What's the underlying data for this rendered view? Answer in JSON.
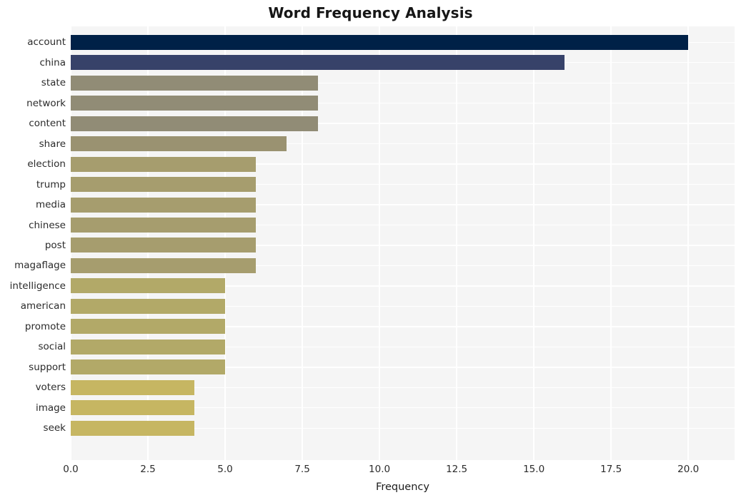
{
  "chart_data": {
    "type": "bar",
    "orientation": "horizontal",
    "title": "Word Frequency Analysis",
    "xlabel": "Frequency",
    "ylabel": "",
    "categories": [
      "account",
      "china",
      "state",
      "network",
      "content",
      "share",
      "election",
      "trump",
      "media",
      "chinese",
      "post",
      "magaflage",
      "intelligence",
      "american",
      "promote",
      "social",
      "support",
      "voters",
      "image",
      "seek"
    ],
    "values": [
      20,
      16,
      8,
      8,
      8,
      7,
      6,
      6,
      6,
      6,
      6,
      6,
      5,
      5,
      5,
      5,
      5,
      4,
      4,
      4
    ],
    "bar_colors": [
      "#002147",
      "#374269",
      "#918c76",
      "#918c76",
      "#918c76",
      "#9a9271",
      "#a69d6e",
      "#a69d6e",
      "#a69d6e",
      "#a69d6e",
      "#a69d6e",
      "#a69d6e",
      "#b2a968",
      "#b2a968",
      "#b2a968",
      "#b2a968",
      "#b2a968",
      "#c6b662",
      "#c6b662",
      "#c6b662"
    ],
    "xlim": [
      0.0,
      21.5
    ],
    "xticks": [
      0.0,
      2.5,
      5.0,
      7.5,
      10.0,
      12.5,
      15.0,
      17.5,
      20.0
    ],
    "xtick_labels": [
      "0.0",
      "2.5",
      "5.0",
      "7.5",
      "10.0",
      "12.5",
      "15.0",
      "17.5",
      "20.0"
    ],
    "grid": true,
    "grid_color": "#ffffff",
    "plot_background": "#f5f5f5",
    "figure_background": "#ffffff",
    "legend": null
  }
}
